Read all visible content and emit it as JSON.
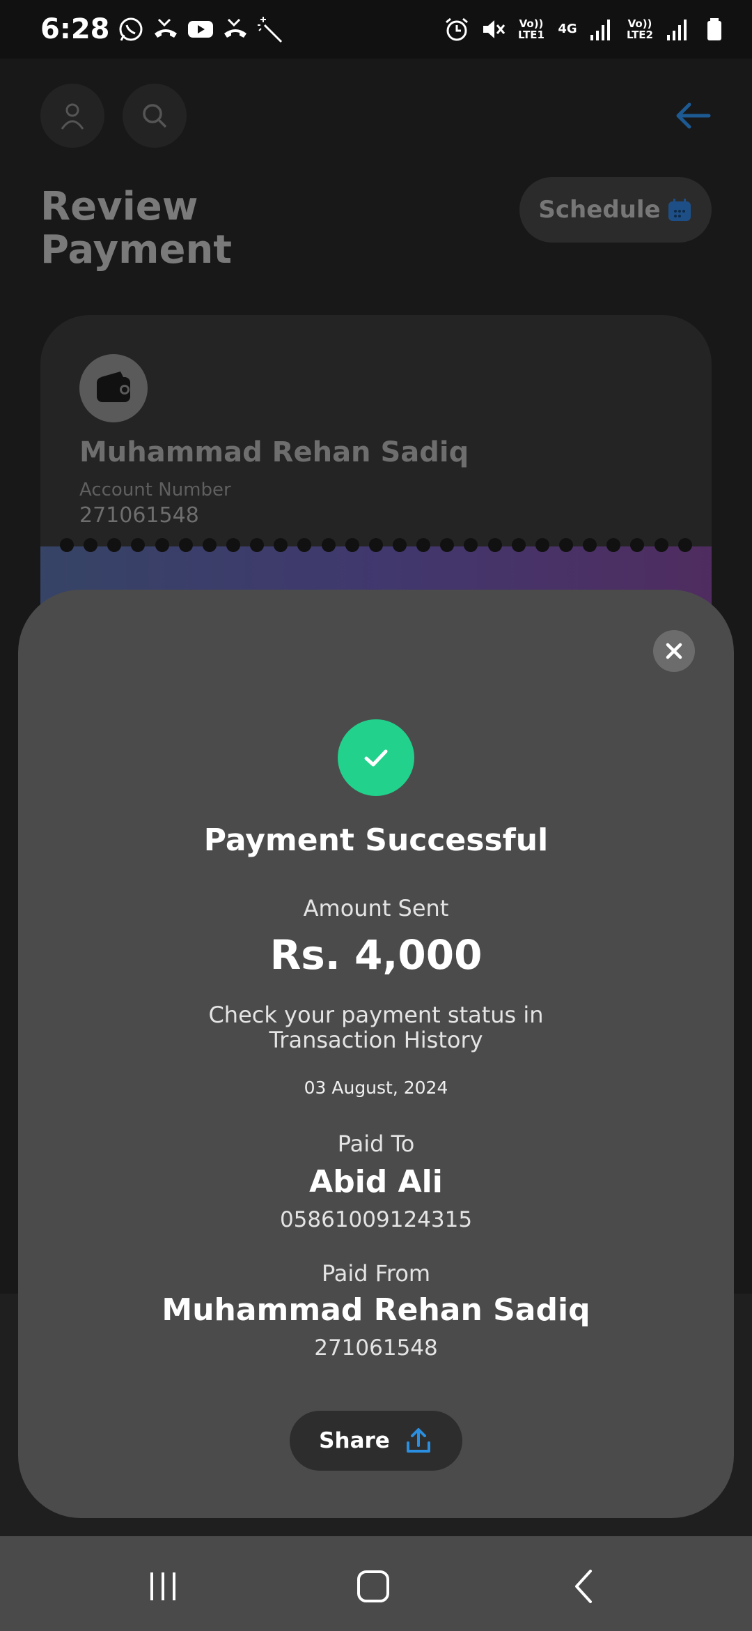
{
  "status_bar": {
    "time": "6:28",
    "left_icons": [
      "whatsapp-icon",
      "missed-call-icon",
      "youtube-icon",
      "missed-call-icon",
      "magic-wand-icon"
    ],
    "right_icons": [
      "alarm-icon",
      "mute-icon",
      "volte-lte1-icon",
      "4g-icon",
      "signal-icon",
      "volte-lte2-icon",
      "signal-icon",
      "battery-icon"
    ],
    "volte1": "Vo)) LTE1",
    "net": "4G",
    "volte2": "Vo)) LTE2"
  },
  "header": {
    "title_line1": "Review",
    "title_line2": "Payment",
    "schedule_label": "Schedule"
  },
  "background_card": {
    "name": "Muhammad Rehan Sadiq",
    "account_label": "Account Number",
    "account_number": "271061548"
  },
  "modal": {
    "title": "Payment Successful",
    "amount_label": "Amount Sent",
    "amount": "Rs. 4,000",
    "status_line1": "Check your payment status in",
    "status_line2": "Transaction History",
    "date": "03 August, 2024",
    "paid_to_label": "Paid To",
    "paid_to_name": "Abid Ali",
    "paid_to_account": "05861009124315",
    "paid_from_label": "Paid From",
    "paid_from_name": "Muhammad Rehan Sadiq",
    "paid_from_account": "271061548",
    "share_label": "Share"
  },
  "colors": {
    "success": "#22d18b",
    "accent": "#2a7fd4",
    "modal_bg": "#4b4b4b"
  }
}
